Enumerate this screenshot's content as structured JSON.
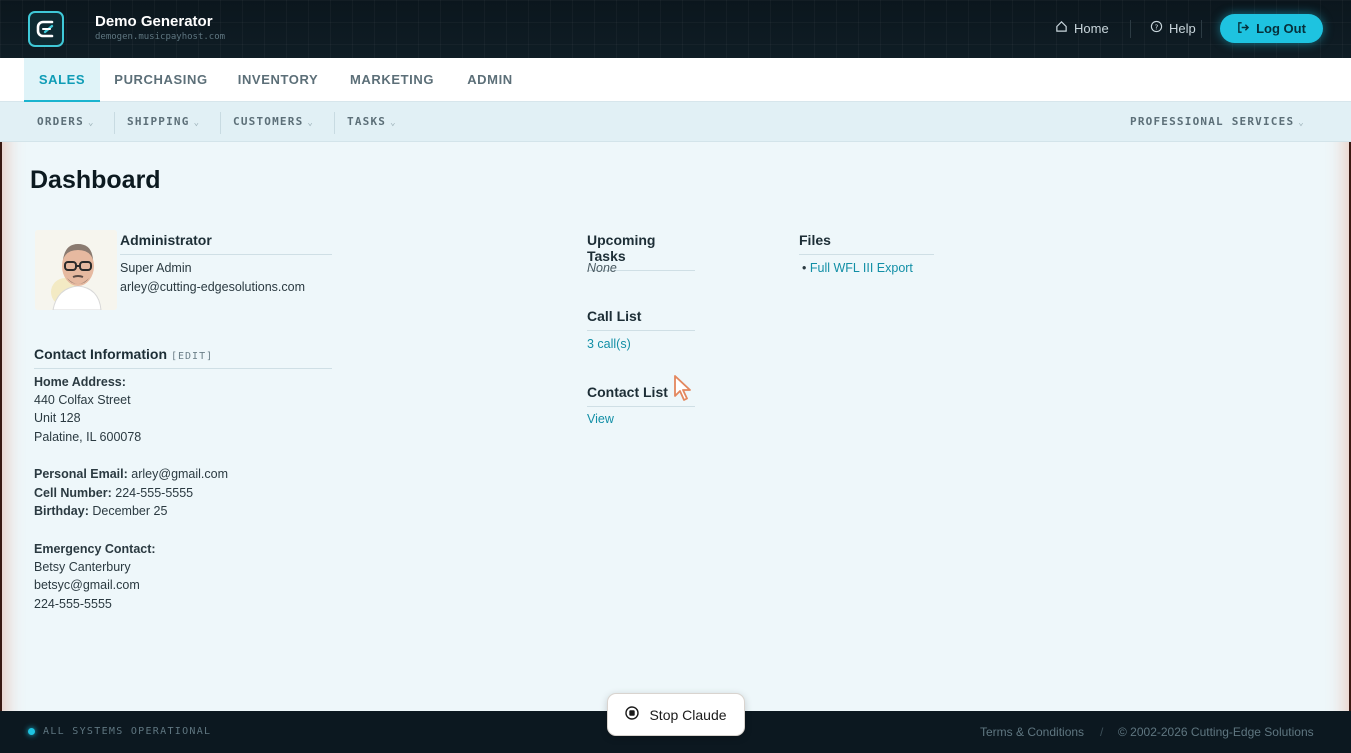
{
  "app": {
    "title": "Demo Generator",
    "subtitle": "demogen.musicpayhost.com",
    "accent_color": "#1ec3e0"
  },
  "header": {
    "home_label": "Home",
    "help_label": "Help",
    "logout_label": "Log Out"
  },
  "main_nav": {
    "tabs": [
      {
        "label": "SALES",
        "active": true
      },
      {
        "label": "PURCHASING",
        "active": false
      },
      {
        "label": "INVENTORY",
        "active": false
      },
      {
        "label": "MARKETING",
        "active": false
      },
      {
        "label": "ADMIN",
        "active": false
      }
    ]
  },
  "sub_nav": {
    "items": [
      {
        "label": "ORDERS"
      },
      {
        "label": "SHIPPING"
      },
      {
        "label": "CUSTOMERS"
      },
      {
        "label": "TASKS"
      }
    ],
    "right_item": {
      "label": "PROFESSIONAL SERVICES"
    }
  },
  "page": {
    "title": "Dashboard"
  },
  "profile": {
    "heading": "Administrator",
    "role": "Super Admin",
    "email": "arley@cutting-edgesolutions.com"
  },
  "contact": {
    "heading": "Contact Information",
    "edit_label": "[EDIT]",
    "home_address_label": "Home Address:",
    "address_line1": "440 Colfax Street",
    "address_line2": "Unit 128",
    "address_line3": "Palatine, IL 600078",
    "personal_email_label": "Personal Email:",
    "personal_email": "arley@gmail.com",
    "cell_label": "Cell Number:",
    "cell": "224-555-5555",
    "birthday_label": "Birthday:",
    "birthday": "December 25",
    "emergency_label": "Emergency Contact:",
    "emergency_name": "Betsy Canterbury",
    "emergency_email": "betsyc@gmail.com",
    "emergency_phone": "224-555-5555"
  },
  "tasks": {
    "heading": "Upcoming Tasks",
    "value": "None"
  },
  "call_list": {
    "heading": "Call List",
    "value": "3 call(s)"
  },
  "contact_list": {
    "heading": "Contact List",
    "value": "View"
  },
  "files": {
    "heading": "Files",
    "items": [
      "Full WFL III Export"
    ]
  },
  "footer": {
    "status": "ALL SYSTEMS OPERATIONAL",
    "terms": "Terms & Conditions",
    "separator": "/",
    "copyright": "© 2002-2026 Cutting-Edge Solutions"
  },
  "overlay": {
    "stop_label": "Stop Claude"
  },
  "icons": {
    "logo": "app-logo-icon",
    "home": "home-icon",
    "help": "help-icon",
    "logout": "logout-icon",
    "stop": "stop-icon",
    "cursor": "mouse-cursor-icon"
  }
}
